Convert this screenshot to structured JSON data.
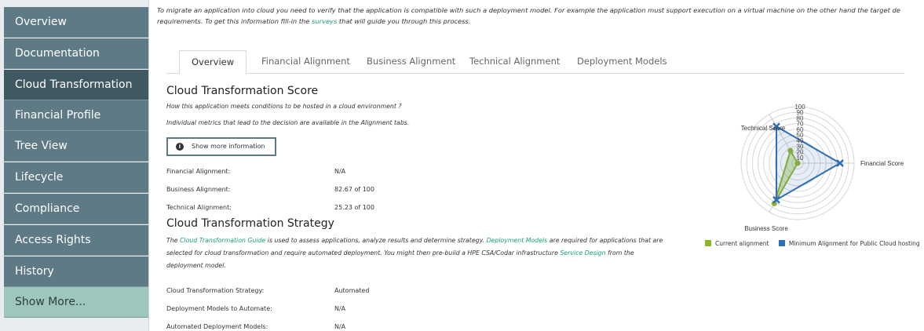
{
  "sidebar": {
    "items": [
      {
        "label": "Overview"
      },
      {
        "label": "Documentation"
      },
      {
        "label": "Cloud Transformation"
      },
      {
        "label": "Financial Profile"
      },
      {
        "label": "Tree View"
      },
      {
        "label": "Lifecycle"
      },
      {
        "label": "Compliance"
      },
      {
        "label": "Access Rights"
      },
      {
        "label": "History"
      },
      {
        "label": "Show More..."
      }
    ],
    "active_index": 2
  },
  "intro": {
    "line1": "To migrate an application into cloud you need to verify that the application is compatible with such a deployment model. For example the application must support execution on a virtual machine on the other hand the target de",
    "line2_prefix": "requirements. To get this information fill-in the ",
    "link_text": "surveys",
    "line2_suffix": " that will guide you through this process."
  },
  "tabs": [
    {
      "label": "Overview",
      "active": true
    },
    {
      "label": "Financial Alignment",
      "active": false
    },
    {
      "label": "Business Alignment",
      "active": false
    },
    {
      "label": "Technical Alignment",
      "active": false
    },
    {
      "label": "Deployment Models",
      "active": false
    }
  ],
  "score": {
    "title": "Cloud Transformation Score",
    "desc1": "How this application meets conditions to be hosted in a cloud environment ?",
    "desc2": "Individual metrics that lead to the decision are available in the Alignment tabs.",
    "button_icon": "info-icon",
    "button_label": "Show more information",
    "rows": [
      {
        "label": "Financial Alignment:",
        "value": "N/A"
      },
      {
        "label": "Business Alignment:",
        "value": "82.67 of 100"
      },
      {
        "label": "Technical Alignment:",
        "value": "25.23 of 100"
      }
    ]
  },
  "strategy": {
    "title": "Cloud Transformation Strategy",
    "desc_p1": "The ",
    "link1": "Cloud Transformation Guide",
    "desc_p2": " is used to assess applications, analyze results and determine strategy. ",
    "link2": "Deployment Models",
    "desc_p3": " are required for applications that are selected for cloud transformation and require automated deployment. You might then pre-build a HPE CSA/Codar infrastructure ",
    "link3": "Service Design",
    "desc_p4": " from the deployment model.",
    "rows": [
      {
        "label": "Cloud Transformation Strategy:",
        "value": "Automated"
      },
      {
        "label": "Deployment Models to Automate:",
        "value": "N/A"
      },
      {
        "label": "Automated Deployment Models:",
        "value": "N/A"
      }
    ]
  },
  "chart_data": {
    "type": "radar",
    "axes": [
      "Financial Score",
      "Business Score",
      "Technical Score"
    ],
    "ticks": [
      "10",
      "20",
      "30",
      "40",
      "50",
      "60",
      "70",
      "80",
      "90",
      "100"
    ],
    "range": [
      0,
      100
    ],
    "series": [
      {
        "name": "Current alignment",
        "color": "#8db62e",
        "values": [
          0,
          82.67,
          25.23
        ]
      },
      {
        "name": "Minimum Alignment for Public Cloud hosting",
        "color": "#2e6fb7",
        "values": [
          75,
          75,
          75
        ]
      }
    ],
    "legend_position": "bottom"
  }
}
